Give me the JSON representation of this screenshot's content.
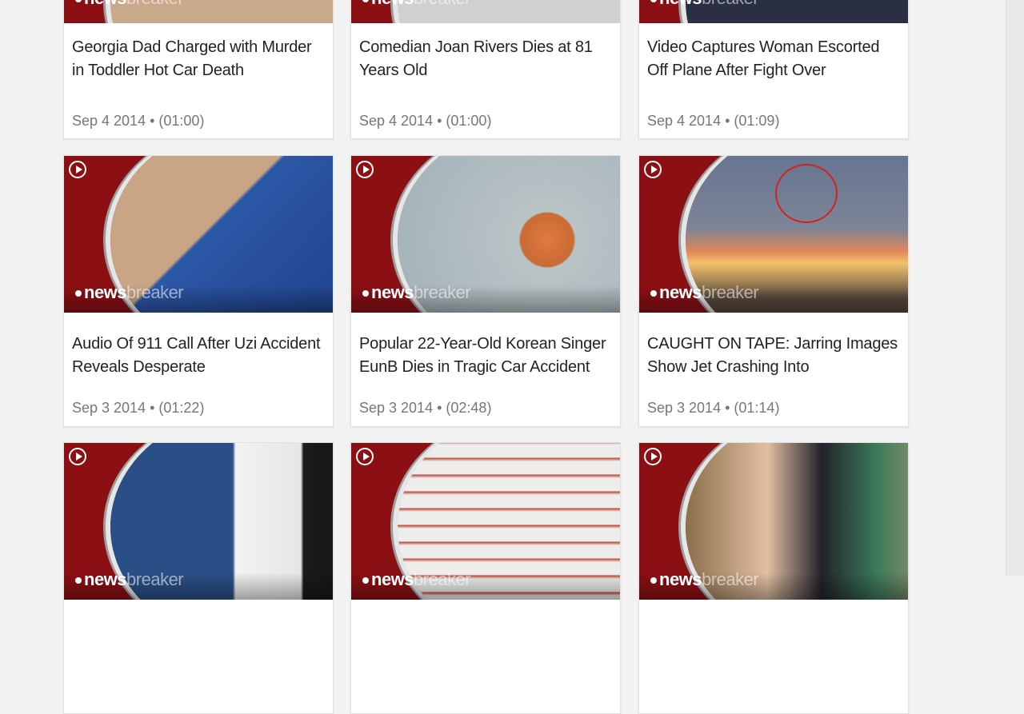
{
  "brand": {
    "news": "news",
    "breaker": "breaker"
  },
  "icons": {
    "play": "play-circle-icon"
  },
  "cards": [
    {
      "title": "Georgia Dad Charged with Murder in Toddler Hot Car Death",
      "date": "Sep 4 2014",
      "duration": "(01:00)",
      "thumb_color": "#c9a98b"
    },
    {
      "title": "Comedian Joan Rivers Dies at 81 Years Old",
      "date": "Sep 4 2014",
      "duration": "(01:00)",
      "thumb_color": "#c8c8c8"
    },
    {
      "title": "Video Captures Woman Escorted Off Plane After Fight Over",
      "date": "Sep 4 2014",
      "duration": "(01:09)",
      "thumb_color": "#2a2f44"
    },
    {
      "title": "Audio Of 911 Call After Uzi Accident Reveals Desperate",
      "date": "Sep 3 2014",
      "duration": "(01:22)",
      "thumb_color": "#2c57a7"
    },
    {
      "title": "Popular 22-Year-Old Korean Singer EunB Dies in Tragic Car Accident",
      "date": "Sep 3 2014",
      "duration": "(02:48)",
      "thumb_color": "#b9c3c6"
    },
    {
      "title": "CAUGHT ON TAPE: Jarring Images Show Jet Crashing Into",
      "date": "Sep 3 2014",
      "duration": "(01:14)",
      "thumb_color": "#6b6e7c"
    },
    {
      "title": "",
      "date": "",
      "duration": "",
      "thumb_color": "#2a4f87"
    },
    {
      "title": "",
      "date": "",
      "duration": "",
      "thumb_color": "#e8e6e3"
    },
    {
      "title": "",
      "date": "",
      "duration": "",
      "thumb_color": "#8a6f4b"
    }
  ]
}
